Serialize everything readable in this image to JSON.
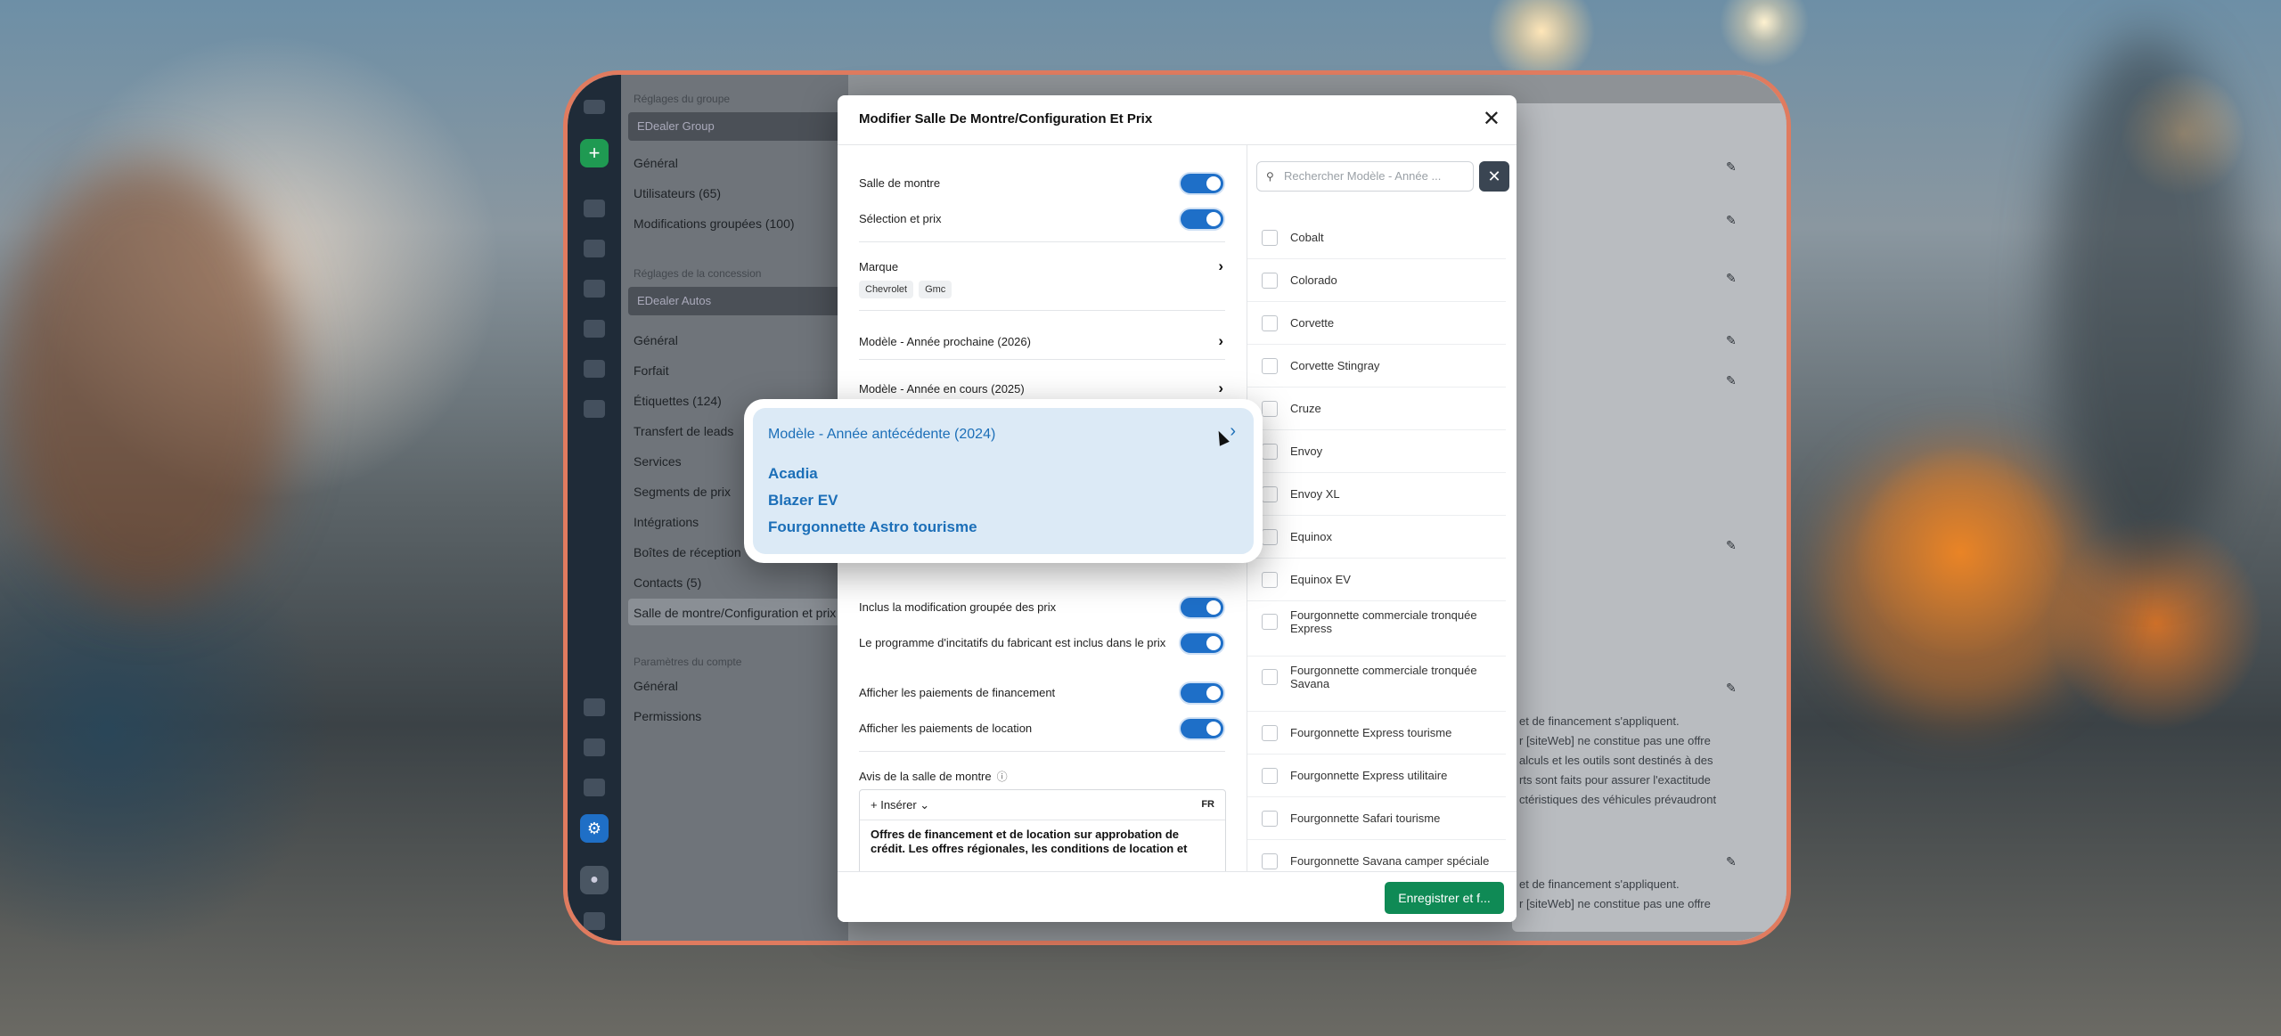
{
  "sidebar": {
    "group_section": "Réglages du groupe",
    "group_select": "EDealer Group",
    "group_items": [
      "Général",
      "Utilisateurs (65)",
      "Modifications groupées (100)"
    ],
    "dealer_section": "Réglages de la concession",
    "dealer_select": "EDealer Autos",
    "dealer_items": [
      "Général",
      "Forfait",
      "Étiquettes (124)",
      "Transfert de leads",
      "Services",
      "Segments de prix",
      "Intégrations",
      "Boîtes de réception",
      "Contacts (5)",
      "Salle de montre/Configuration et prix"
    ],
    "account_section": "Paramètres du compte",
    "account_items": [
      "Général",
      "Permissions"
    ]
  },
  "background_text": [
    "et de financement s'appliquent.",
    "r [siteWeb] ne constitue pas une offre",
    "alculs et les outils sont destinés à des",
    "rts sont faits pour assurer l'exactitude",
    "ctéristiques des véhicules prévaudront",
    "et de financement s'appliquent.",
    "r [siteWeb] ne constitue pas une offre"
  ],
  "modal": {
    "title": "Modifier Salle De Montre/Configuration Et Prix",
    "toggles_top": [
      {
        "label": "Salle de montre",
        "on": true
      },
      {
        "label": "Sélection et prix",
        "on": true
      }
    ],
    "brand_label": "Marque",
    "brand_chips": [
      "Chevrolet",
      "Gmc"
    ],
    "model_next": "Modèle - Année prochaine (2026)",
    "model_current": "Modèle - Année en cours (2025)",
    "toggles_bottom": [
      {
        "label": "Inclus la modification groupée des prix",
        "on": true
      },
      {
        "label": "Le programme d'incitatifs du fabricant est inclus dans le prix",
        "on": true
      },
      {
        "label": "Afficher les paiements de financement",
        "on": true
      },
      {
        "label": "Afficher les paiements de location",
        "on": true
      }
    ],
    "notice_label": "Avis de la salle de montre",
    "editor": {
      "insert": "Insérer",
      "lang": "FR",
      "text": "Offres de financement et de location sur approbation de crédit. Les offres régionales, les conditions de location et"
    },
    "search_placeholder": "Rechercher Modèle - Année ...",
    "models": [
      "Cobalt",
      "Colorado",
      "Corvette",
      "Corvette Stingray",
      "Cruze",
      "Envoy",
      "Envoy XL",
      "Equinox",
      "Equinox EV",
      "Fourgonnette commerciale tronquée Express",
      "Fourgonnette commerciale tronquée Savana",
      "Fourgonnette Express tourisme",
      "Fourgonnette Express utilitaire",
      "Fourgonnette Safari tourisme",
      "Fourgonnette Savana camper spéciale"
    ],
    "save_label": "Enregistrer et f..."
  },
  "popup": {
    "title": "Modèle - Année antécédente (2024)",
    "items": [
      "Acadia",
      "Blazer EV",
      "Fourgonnette Astro tourisme"
    ]
  },
  "colors": {
    "accent": "#1e6fc8",
    "save": "#0f8a55",
    "frame": "#e07b5f"
  }
}
